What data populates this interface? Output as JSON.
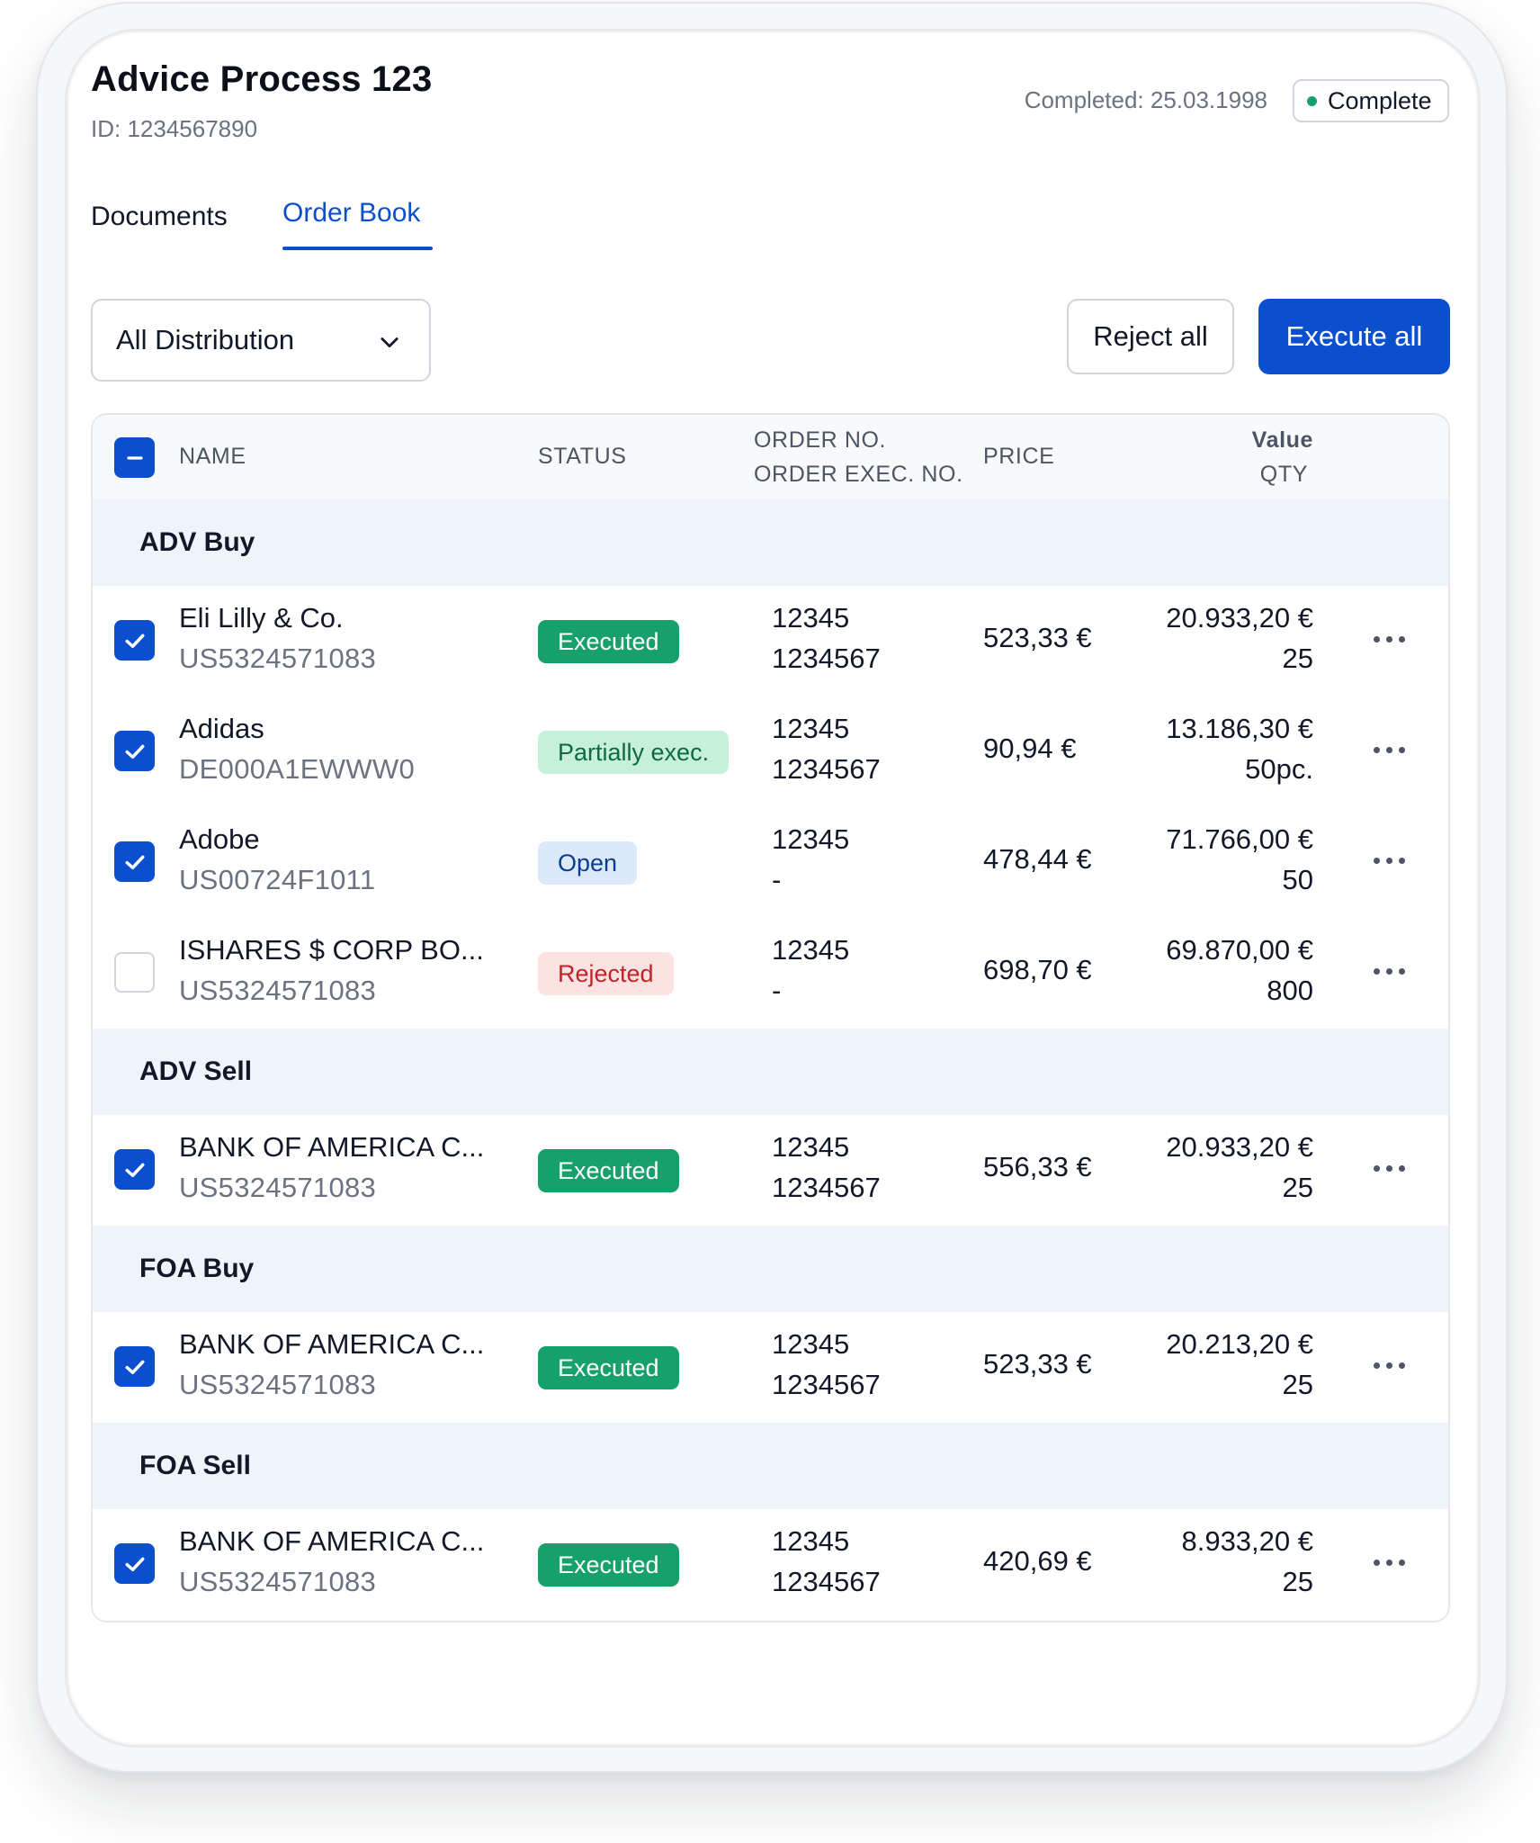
{
  "header": {
    "title": "Advice Process 123",
    "id_text": "ID: 1234567890",
    "completed_text": "Completed: 25.03.1998",
    "status_badge": "Complete",
    "status_color": "#16a06a"
  },
  "tabs": [
    {
      "label": "Documents",
      "active": false
    },
    {
      "label": "Order Book",
      "active": true
    }
  ],
  "filter": {
    "selected": "All Distribution",
    "icon": "chevron-down-icon"
  },
  "actions": {
    "reject_label": "Reject all",
    "execute_label": "Execute all"
  },
  "accent_color": "#0b4fcf",
  "table": {
    "columns": {
      "name": "NAME",
      "status": "STATUS",
      "order_no": "ORDER NO.",
      "order_exec_no": "ORDER EXEC. NO.",
      "price": "PRICE",
      "value": "Value",
      "qty": "QTY"
    },
    "groups": [
      {
        "label": "ADV Buy",
        "rows": [
          {
            "name": "Eli Lilly & Co.",
            "isin": "US5324571083",
            "status": "Executed",
            "order_no": "12345",
            "exec_no": "1234567",
            "price": "523,33 €",
            "value": "20.933,20 €",
            "qty": "25",
            "checked": true
          },
          {
            "name": "Adidas",
            "isin": "DE000A1EWWW0",
            "status": "Partially exec.",
            "order_no": "12345",
            "exec_no": "1234567",
            "price": "90,94 €",
            "value": "13.186,30 €",
            "qty": "50pc.",
            "checked": true
          },
          {
            "name": "Adobe",
            "isin": "US00724F1011",
            "status": "Open",
            "order_no": "12345",
            "exec_no": "-",
            "price": "478,44 €",
            "value": "71.766,00 €",
            "qty": "50",
            "checked": true
          },
          {
            "name": "ISHARES $ CORP BO...",
            "isin": "US5324571083",
            "status": "Rejected",
            "order_no": "12345",
            "exec_no": "-",
            "price": "698,70 €",
            "value": "69.870,00 €",
            "qty": "800",
            "checked": false
          }
        ]
      },
      {
        "label": "ADV Sell",
        "rows": [
          {
            "name": "BANK OF AMERICA C...",
            "isin": "US5324571083",
            "status": "Executed",
            "order_no": "12345",
            "exec_no": "1234567",
            "price": "556,33 €",
            "value": "20.933,20 €",
            "qty": "25",
            "checked": true
          }
        ]
      },
      {
        "label": "FOA Buy",
        "rows": [
          {
            "name": "BANK OF AMERICA C...",
            "isin": "US5324571083",
            "status": "Executed",
            "order_no": "12345",
            "exec_no": "1234567",
            "price": "523,33 €",
            "value": "20.213,20 €",
            "qty": "25",
            "checked": true
          }
        ]
      },
      {
        "label": "FOA Sell",
        "rows": [
          {
            "name": "BANK OF AMERICA C...",
            "isin": "US5324571083",
            "status": "Executed",
            "order_no": "12345",
            "exec_no": "1234567",
            "price": "420,69 €",
            "value": "8.933,20 €",
            "qty": "25",
            "checked": true
          }
        ]
      }
    ]
  }
}
